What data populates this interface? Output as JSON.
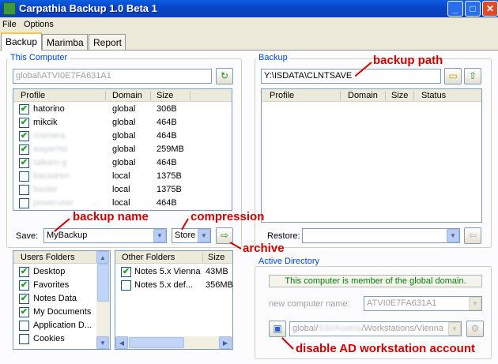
{
  "window": {
    "title": "Carpathia Backup 1.0 Beta 1"
  },
  "menu": [
    "File",
    "Options"
  ],
  "tabs": [
    "Backup",
    "Marimba",
    "Report"
  ],
  "this_computer": {
    "label": "This Computer",
    "path": "global\\ATVI0E7FA631A1",
    "columns": [
      "Profile",
      "Domain",
      "Size"
    ],
    "profiles": [
      {
        "name": "hatorino",
        "domain": "global",
        "size": "306B",
        "checked": true,
        "blurred": false
      },
      {
        "name": "mikcik",
        "domain": "global",
        "size": "464B",
        "checked": true,
        "blurred": false
      },
      {
        "name": "rosmera",
        "domain": "global",
        "size": "464B",
        "checked": true,
        "blurred": true
      },
      {
        "name": "wayerhtz",
        "domain": "global",
        "size": "259MB",
        "checked": true,
        "blurred": true
      },
      {
        "name": "talkam-g",
        "domain": "global",
        "size": "464B",
        "checked": true,
        "blurred": true
      },
      {
        "name": "bacadren",
        "domain": "local",
        "size": "1375B",
        "checked": false,
        "blurred": true
      },
      {
        "name": "baxter",
        "domain": "local",
        "size": "1375B",
        "checked": false,
        "blurred": true
      },
      {
        "name": "poweruser",
        "domain": "local",
        "size": "464B",
        "checked": false,
        "blurred": true
      }
    ],
    "save_label": "Save:",
    "save_value": "MyBackup",
    "compression_value": "Store"
  },
  "users_folders": {
    "header": "Users Folders",
    "items": [
      {
        "name": "Desktop",
        "checked": true
      },
      {
        "name": "Favorites",
        "checked": true
      },
      {
        "name": "Notes Data",
        "checked": true
      },
      {
        "name": "My Documents",
        "checked": true
      },
      {
        "name": "Application D...",
        "checked": false
      },
      {
        "name": "Cookies",
        "checked": false
      }
    ]
  },
  "other_folders": {
    "columns": [
      "Other Folders",
      "Size"
    ],
    "items": [
      {
        "name": "Notes 5.x Vienna",
        "size": "43MB",
        "checked": true
      },
      {
        "name": "Notes 5.x def...",
        "size": "356MB",
        "checked": false
      }
    ]
  },
  "backup": {
    "label": "Backup",
    "path": "Y:\\ISDATA\\CLNTSAVE",
    "columns": [
      "Profile",
      "Domain",
      "Size",
      "Status"
    ],
    "restore_label": "Restore:"
  },
  "active_directory": {
    "label": "Active Directory",
    "message": "This computer is member of the global domain.",
    "new_name_label": "new computer name:",
    "new_name_value": "ATVI0E7FA631A1",
    "ou_path_prefix": "global/",
    "ou_path_hidden": "SSI/Austria",
    "ou_path_suffix": "/Workstations/Vienna"
  },
  "annotations": {
    "backup_path": "backup path",
    "backup_name": "backup name",
    "compression": "compression",
    "archive": "archive",
    "disable_ad": "disable AD workstation account"
  },
  "colors": {
    "accent": "#0046d5",
    "annotation": "#d00000",
    "message": "#008000",
    "check": "#21a121"
  }
}
